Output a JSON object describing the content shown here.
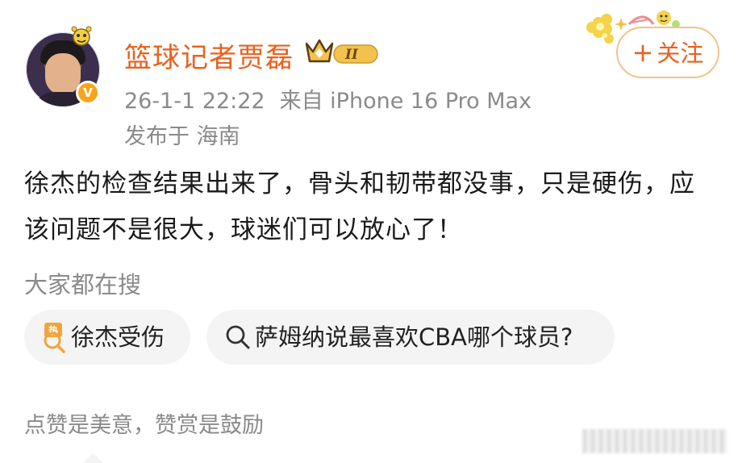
{
  "post": {
    "author": {
      "name": "篮球记者贾磊",
      "level_badge": "II",
      "verified_mark": "V"
    },
    "meta": {
      "time": "26-1-1 22:22",
      "source": "来自 iPhone 16 Pro Max",
      "location": "发布于 海南"
    },
    "follow_button": {
      "plus": "+",
      "label": "关注"
    },
    "content": "徐杰的检查结果出来了，骨头和韧带都没事，只是硬伤，应该问题不是很大，球迷们可以放心了！"
  },
  "trending": {
    "title": "大家都在搜",
    "items": [
      {
        "icon": "hot-icon",
        "label": "徐杰受伤"
      },
      {
        "icon": "search-icon",
        "label": "萨姆纳说最喜欢CBA哪个球员?"
      }
    ]
  },
  "reward": {
    "text": "点赞是美意，赞赏是鼓励"
  },
  "colors": {
    "accent": "#e8611f",
    "muted": "#8a8a8a",
    "pill_bg": "#f4f4f4",
    "follow_border": "#f0c28a",
    "verified": "#f7a51c"
  }
}
